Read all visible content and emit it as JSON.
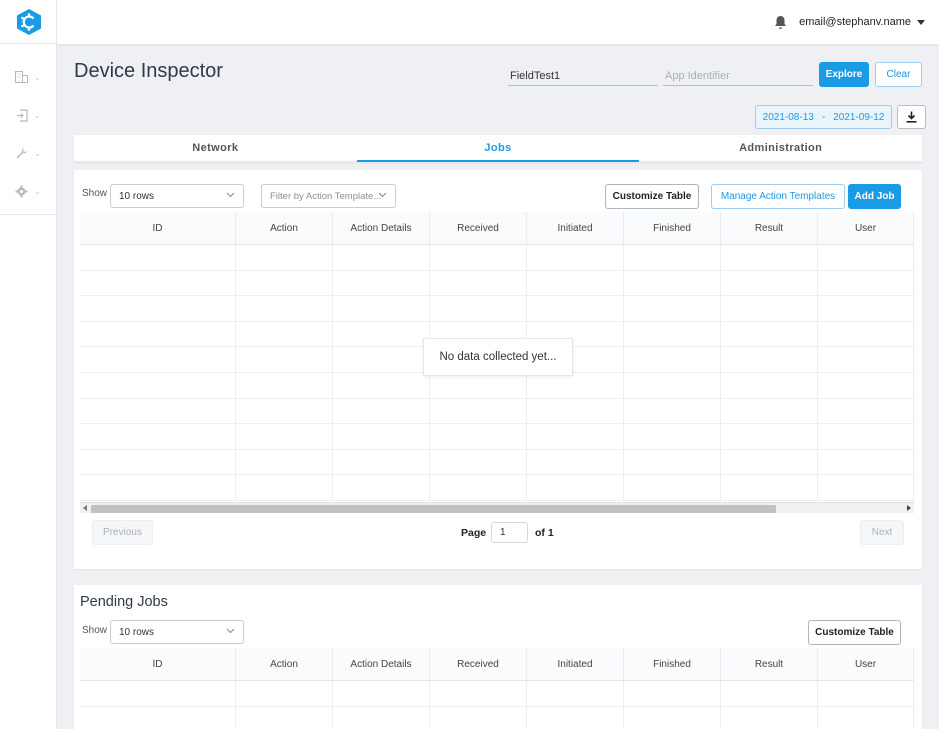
{
  "app": {
    "brand_color": "#1a9be6"
  },
  "sidebar": {
    "items": [
      {
        "icon": "building-icon"
      },
      {
        "icon": "sign-in-icon"
      },
      {
        "icon": "wrench-icon"
      },
      {
        "icon": "gear-icon"
      }
    ]
  },
  "topbar": {
    "user_email": "email@stephanv.name"
  },
  "header": {
    "title": "Device Inspector",
    "device_field": {
      "value": "FieldTest1",
      "placeholder": ""
    },
    "app_field": {
      "value": "",
      "placeholder": "App Identifier"
    },
    "explore_label": "Explore",
    "clear_label": "Clear",
    "date_start": "2021-08-13",
    "date_separator": "-",
    "date_end": "2021-09-12"
  },
  "tabs": [
    {
      "label": "Network",
      "active": false
    },
    {
      "label": "Jobs",
      "active": true
    },
    {
      "label": "Administration",
      "active": false
    }
  ],
  "jobs": {
    "show_label": "Show",
    "rows_select": "10 rows",
    "filter_placeholder": "Filter by Action Template...",
    "customize_label": "Customize Table",
    "manage_label": "Manage Action Templates",
    "add_label": "Add Job",
    "columns": [
      "ID",
      "Action",
      "Action Details",
      "Received",
      "Initiated",
      "Finished",
      "Result",
      "User"
    ],
    "empty_message": "No data collected yet...",
    "pager": {
      "previous_label": "Previous",
      "page_label": "Page",
      "page_value": "1",
      "of_label": "of 1",
      "next_label": "Next"
    }
  },
  "pending": {
    "title": "Pending Jobs",
    "show_label": "Show",
    "rows_select": "10 rows",
    "customize_label": "Customize Table",
    "columns": [
      "ID",
      "Action",
      "Action Details",
      "Received",
      "Initiated",
      "Finished",
      "Result",
      "User"
    ]
  }
}
